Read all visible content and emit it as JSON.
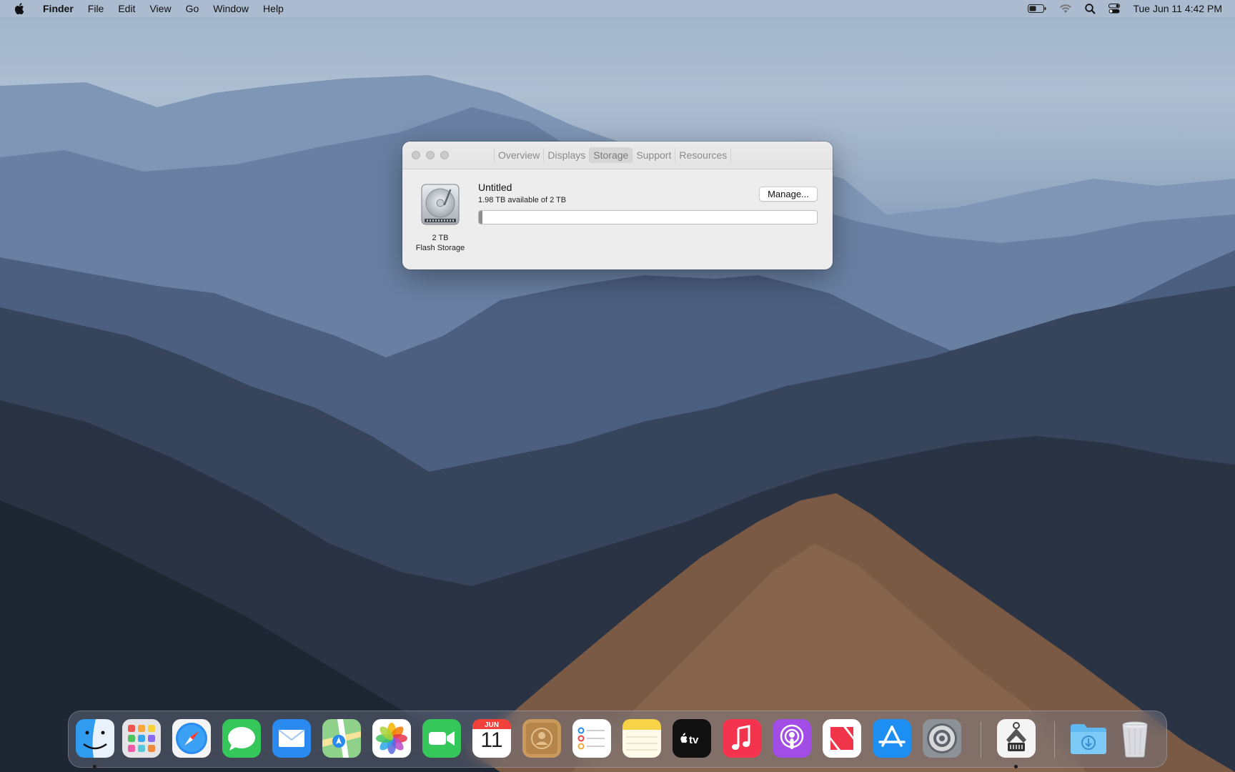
{
  "menubar": {
    "app_name": "Finder",
    "items": [
      "File",
      "Edit",
      "View",
      "Go",
      "Window",
      "Help"
    ],
    "clock": "Tue Jun 11  4:42 PM",
    "status_icons": [
      "battery-icon",
      "wifi-icon",
      "spotlight-search-icon",
      "control-center-icon"
    ]
  },
  "window": {
    "tabs": [
      "Overview",
      "Displays",
      "Storage",
      "Support",
      "Resources"
    ],
    "active_tab": "Storage",
    "storage": {
      "volume_name": "Untitled",
      "available_text": "1.98 TB available of 2 TB",
      "disk_size": "2 TB",
      "disk_type": "Flash Storage",
      "manage_label": "Manage...",
      "used_fraction": 0.01
    }
  },
  "dock": {
    "apps": [
      {
        "name": "finder-icon",
        "running": true
      },
      {
        "name": "launchpad-icon",
        "running": false
      },
      {
        "name": "safari-icon",
        "running": false
      },
      {
        "name": "messages-icon",
        "running": false
      },
      {
        "name": "mail-icon",
        "running": false
      },
      {
        "name": "maps-icon",
        "running": false
      },
      {
        "name": "photos-icon",
        "running": false
      },
      {
        "name": "facetime-icon",
        "running": false
      },
      {
        "name": "calendar-icon",
        "running": false
      },
      {
        "name": "contacts-icon",
        "running": false
      },
      {
        "name": "reminders-icon",
        "running": false
      },
      {
        "name": "notes-icon",
        "running": false
      },
      {
        "name": "apple-tv-icon",
        "running": false
      },
      {
        "name": "music-icon",
        "running": false
      },
      {
        "name": "podcasts-icon",
        "running": false
      },
      {
        "name": "news-icon",
        "running": false
      },
      {
        "name": "app-store-icon",
        "running": false
      },
      {
        "name": "system-settings-icon",
        "running": false
      },
      {
        "name": "system-information-icon",
        "running": true
      },
      {
        "name": "downloads-folder-icon",
        "running": false
      },
      {
        "name": "trash-icon",
        "running": false
      }
    ],
    "calendar": {
      "month": "JUN",
      "day": "11"
    }
  }
}
